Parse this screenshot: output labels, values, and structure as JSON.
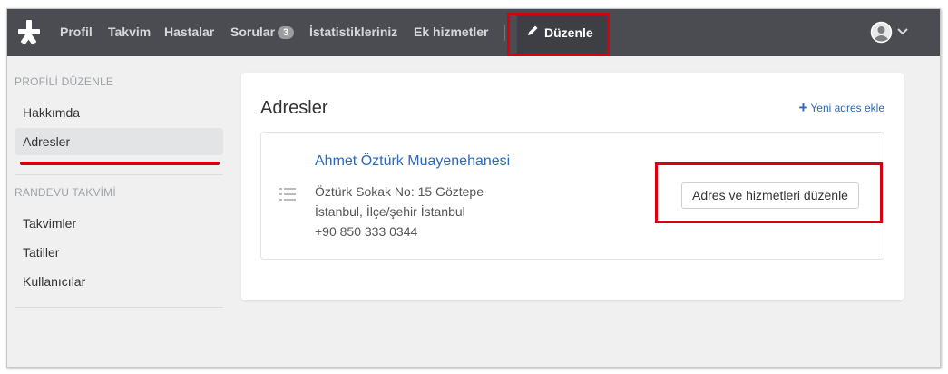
{
  "topnav": {
    "items": [
      "Profil",
      "Takvim",
      "Hastalar",
      "Sorular",
      "İstatistikleriniz",
      "Ek hizmetler"
    ],
    "questions_count": "3",
    "edit_label": "Düzenle",
    "logo_icon": "docplanner-star-logo",
    "avatar_icon": "user-avatar-icon",
    "caret_icon": "chevron-down-icon"
  },
  "sidebar": {
    "profile_section": "PROFİLİ DÜZENLE",
    "profile_items": [
      "Hakkımda",
      "Adresler"
    ],
    "active_item": "Adresler",
    "appointment_section": "RANDEVU TAKVİMİ",
    "appointment_items": [
      "Takvimler",
      "Tatiller",
      "Kullanıcılar"
    ]
  },
  "main": {
    "title": "Adresler",
    "add_address_label": "Yeni adres ekle",
    "address": {
      "clinic_name": "Ahmet Öztürk Muayenehanesi",
      "street": "Öztürk Sokak No: 15 Göztepe",
      "city": "İstanbul, İlçe/şehir İstanbul",
      "phone": "+90 850 333 0344",
      "edit_button_label": "Adres ve hizmetleri düzenle"
    }
  },
  "colors": {
    "topbar": "#4a4c51",
    "link": "#2d69b5",
    "highlight": "#d9000d"
  }
}
